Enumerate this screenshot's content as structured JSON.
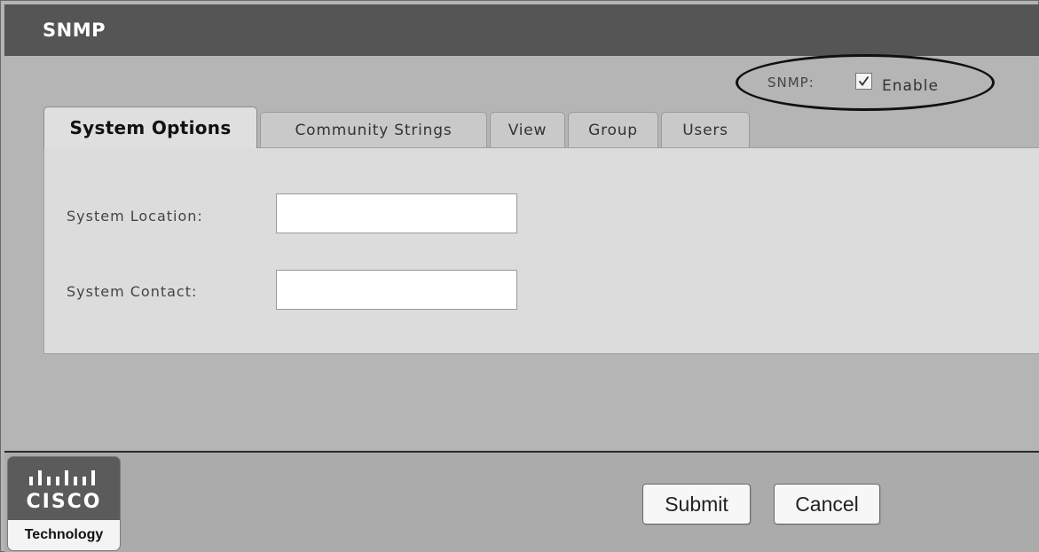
{
  "header": {
    "title": "SNMP"
  },
  "snmp": {
    "label": "SNMP:",
    "checkbox_label": "Enable",
    "checked": true
  },
  "tabs": [
    {
      "label": "System Options",
      "active": true
    },
    {
      "label": "Community Strings",
      "active": false
    },
    {
      "label": "View",
      "active": false
    },
    {
      "label": "Group",
      "active": false
    },
    {
      "label": "Users",
      "active": false
    }
  ],
  "form": {
    "location_label": "System Location:",
    "location_value": "",
    "contact_label": "System Contact:",
    "contact_value": ""
  },
  "buttons": {
    "submit": "Submit",
    "cancel": "Cancel"
  },
  "logo": {
    "word": "CISCO",
    "tagline": "Technology"
  }
}
